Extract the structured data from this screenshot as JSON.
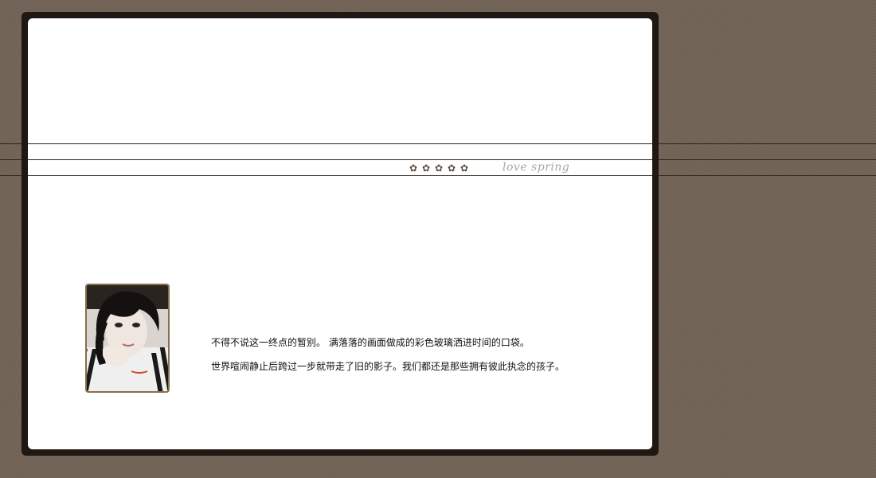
{
  "decoration": {
    "flower_icons": [
      "flower-icon",
      "flower-icon",
      "flower-icon",
      "flower-icon",
      "flower-icon"
    ],
    "flower_glyph": "✿",
    "tagline": "love spring"
  },
  "profile": {
    "avatar_icon": "portrait-photo"
  },
  "quotes": {
    "line1": "不得不说这一终点的暂别。 满落落的画面做成的彩色玻璃洒进时间的口袋。",
    "line2": "世界喧闹静止后跨过一步就带走了旧的影子。我们都还是那些拥有彼此执念的孩子。"
  },
  "colors": {
    "background": "#75675a",
    "frame": "#1f1711",
    "card": "#ffffff",
    "tagline": "#a9a6a2",
    "avatar_border": "#8a6e4c"
  }
}
